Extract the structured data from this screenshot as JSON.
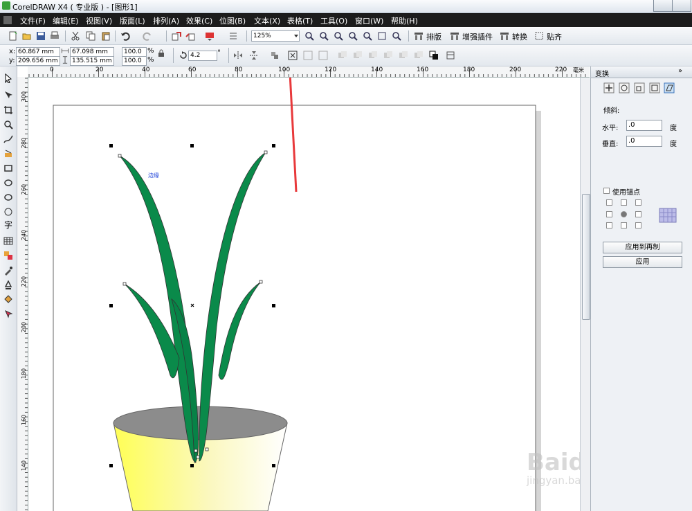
{
  "app": {
    "title": "CorelDRAW X4 ( 专业版 ) - [图形1]"
  },
  "menu": [
    "文件(F)",
    "编辑(E)",
    "视图(V)",
    "版面(L)",
    "排列(A)",
    "效果(C)",
    "位图(B)",
    "文本(X)",
    "表格(T)",
    "工具(O)",
    "窗口(W)",
    "帮助(H)"
  ],
  "toolbar": {
    "zoom_value": "125%",
    "buttons": {
      "layout": "排版",
      "plugins": "增强插件",
      "convert": "转换",
      "snap": "贴齐"
    }
  },
  "property_bar": {
    "x": "60.867 mm",
    "y": "209.656 mm",
    "width": "67.098 mm",
    "height": "135.515 mm",
    "scale_x": "100.0",
    "scale_y": "100.0",
    "percent": "%",
    "rotation": "4.2",
    "degree": "°"
  },
  "ruler_top": [
    "0",
    "20",
    "40",
    "60",
    "80",
    "100",
    "120",
    "140",
    "160",
    "180",
    "200",
    "220"
  ],
  "ruler_unit": "毫米",
  "ruler_left": [
    "300",
    "280",
    "260",
    "240",
    "220",
    "200",
    "180",
    "160",
    "140"
  ],
  "canvas_label": "边缘",
  "docker": {
    "title": "变换",
    "section": "倾斜:",
    "horizontal_label": "水平:",
    "horizontal_value": ".0",
    "vertical_label": "垂直:",
    "vertical_value": ".0",
    "unit": "度",
    "anchor_label": "使用锚点",
    "apply_duplicate": "应用到再制",
    "apply": "应用"
  },
  "watermark": {
    "brand": "Baidu经验",
    "url": "jingyan.baidu.com"
  },
  "colors": {
    "leaf": "#0a8a4a",
    "pot_rim": "#8c8c8c",
    "arrow": "#e8393b"
  }
}
